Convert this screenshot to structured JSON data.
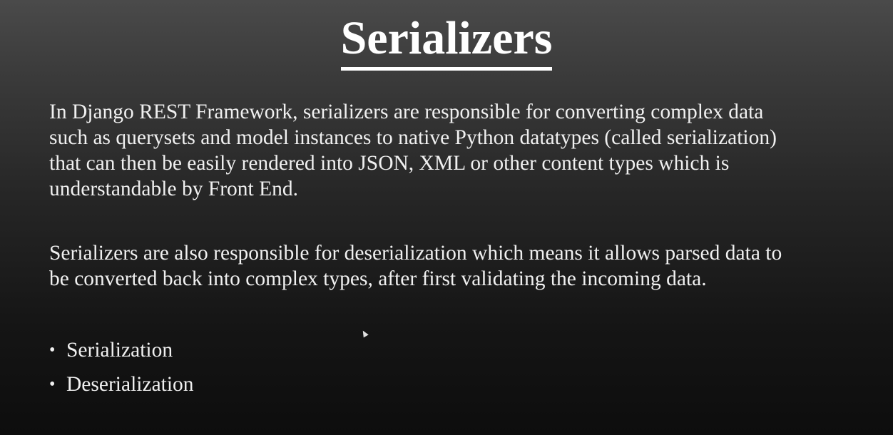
{
  "slide": {
    "title": "Serializers",
    "paragraph1": [
      "In Django REST Framework, serializers are responsible for converting complex data",
      "such as querysets and model instances to native Python datatypes (called serialization)",
      "that can then be easily rendered into JSON, XML or other content types which is",
      "understandable by Front End."
    ],
    "paragraph2": [
      "Serializers are also responsible for deserialization which means it allows parsed data to",
      "be converted back into complex types, after first validating the incoming data."
    ],
    "bullets": [
      "Serialization",
      "Deserialization"
    ],
    "bullet_glyph": "•",
    "cursor_icon": "mouse-pointer-icon"
  }
}
